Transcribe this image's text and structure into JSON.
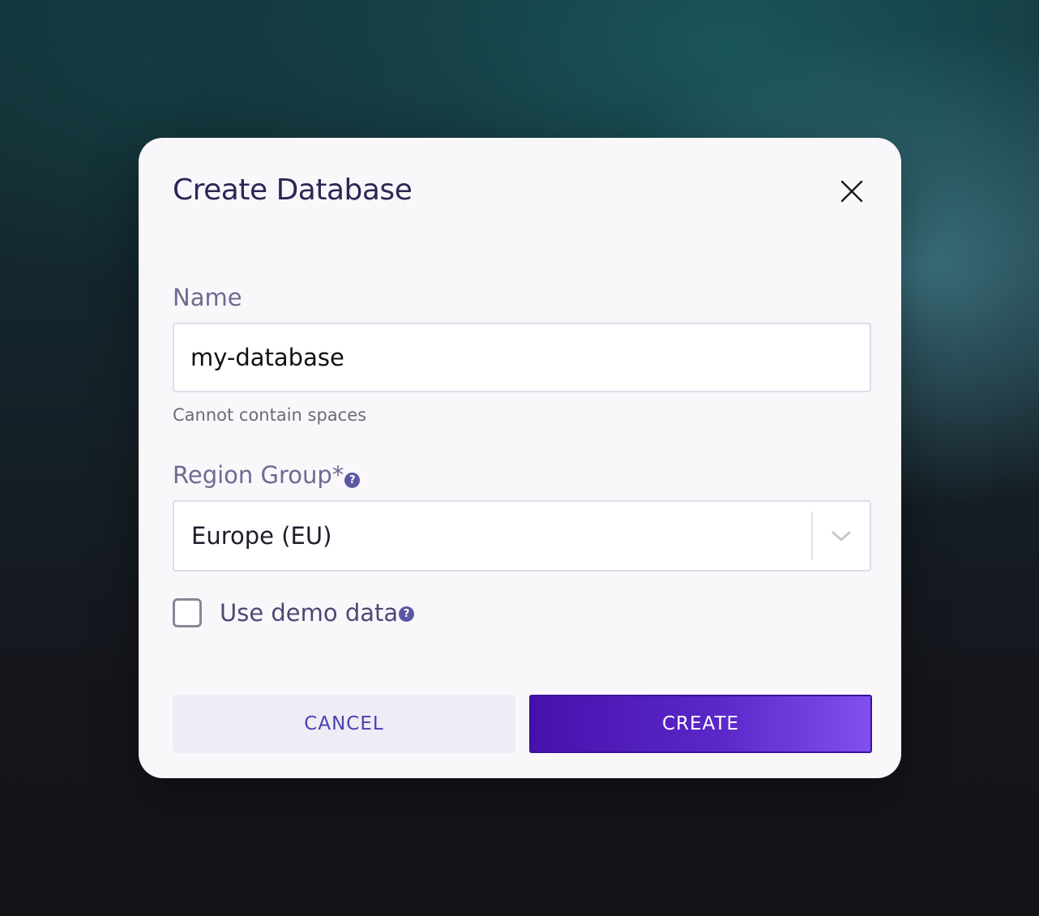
{
  "dialog": {
    "title": "Create Database",
    "close_icon": "close-icon"
  },
  "name_field": {
    "label": "Name",
    "value": "my-database",
    "helper_text": "Cannot contain spaces"
  },
  "region_field": {
    "label": "Region Group*",
    "help_icon": "question-circle-icon",
    "help_glyph": "?",
    "selected_value": "Europe (EU)",
    "chevron_icon": "chevron-down-icon"
  },
  "demo_data": {
    "label": "Use demo data",
    "checked": false,
    "help_icon": "question-circle-icon",
    "help_glyph": "?"
  },
  "actions": {
    "cancel_label": "CANCEL",
    "create_label": "CREATE"
  },
  "colors": {
    "title": "#2c2755",
    "label": "#6f6a92",
    "accent": "#4a3fb0",
    "primary_gradient_start": "#4710ad",
    "primary_gradient_end": "#7f4ff0",
    "dialog_background": "#faf7fb"
  }
}
